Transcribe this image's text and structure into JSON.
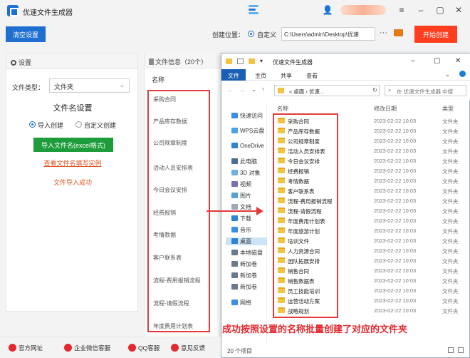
{
  "app": {
    "title": "优速文件生成器"
  },
  "toolbar": {
    "clear_label": "清空设置",
    "location_label": "创建位置：",
    "custom_label": "自定义",
    "path_value": "C:\\Users\\admin\\Desktop\\优速",
    "more": "···",
    "start_label": "开始创建"
  },
  "settings": {
    "header": "设置",
    "filetype_label": "文件类型：",
    "filetype_value": "文件夹",
    "filename_title": "文件名设置",
    "opt_import": "导入创建",
    "opt_custom": "自定义创建",
    "import_button": "导入文件名(excel格式)",
    "example_link": "查看文件名填写实例",
    "import_status": "文件导入成功"
  },
  "fileinfo": {
    "header": "文件信息（20个）",
    "col_name": "名称",
    "rows": [
      "采购合同",
      "产品库存数据",
      "公司规章制度",
      "活动人员安排表",
      "今日会议安排",
      "经费报销",
      "考情数据",
      "客户联系表",
      "流程-费用报销流程",
      "流程-请假流程",
      "年度费用计划表"
    ]
  },
  "explorer": {
    "title": "优速文件生成器",
    "tabs": [
      "文件",
      "主页",
      "共享",
      "查看"
    ],
    "address": "« 桌面 › 优速...",
    "search_placeholder": "在 优速文件生成器 中搜",
    "nav": [
      "快速访问",
      "WPS云盘",
      "OneDrive",
      "此电脑",
      "3D 对象",
      "视频",
      "图片",
      "文档",
      "下载",
      "音乐",
      "桌面",
      "本地磁盘",
      "新加卷",
      "新加卷",
      "新加卷",
      "网络"
    ],
    "col_name": "名称",
    "col_date": "修改日期",
    "col_type": "类型",
    "date": "2023-02-22 10:03",
    "type": "文件夹",
    "files": [
      "采购合同",
      "产品库存数据",
      "公司规章制度",
      "活动人员安排表",
      "今日会议安排",
      "经费报销",
      "考情数据",
      "客户联系表",
      "流程-费用报销流程",
      "流程-请假流程",
      "年度费用计划表",
      "年度旅游计划",
      "培训文件",
      "人力资源合同",
      "团队拓展安排",
      "销售合同",
      "销售数据表",
      "员工技能培训",
      "运营活动方案",
      "战略规划"
    ],
    "status": "20 个项目"
  },
  "caption": "成功按照设置的名称批量创建了对应的文件夹",
  "bottom": {
    "official": "官方网址",
    "wechat": "企业微信客服",
    "qq": "QQ客服",
    "feedback": "意见反馈"
  },
  "colors": {
    "primary": "#1f6fd1",
    "start": "#ff3d1f",
    "import": "#1c9c3a",
    "highlight": "#e33b3b"
  }
}
